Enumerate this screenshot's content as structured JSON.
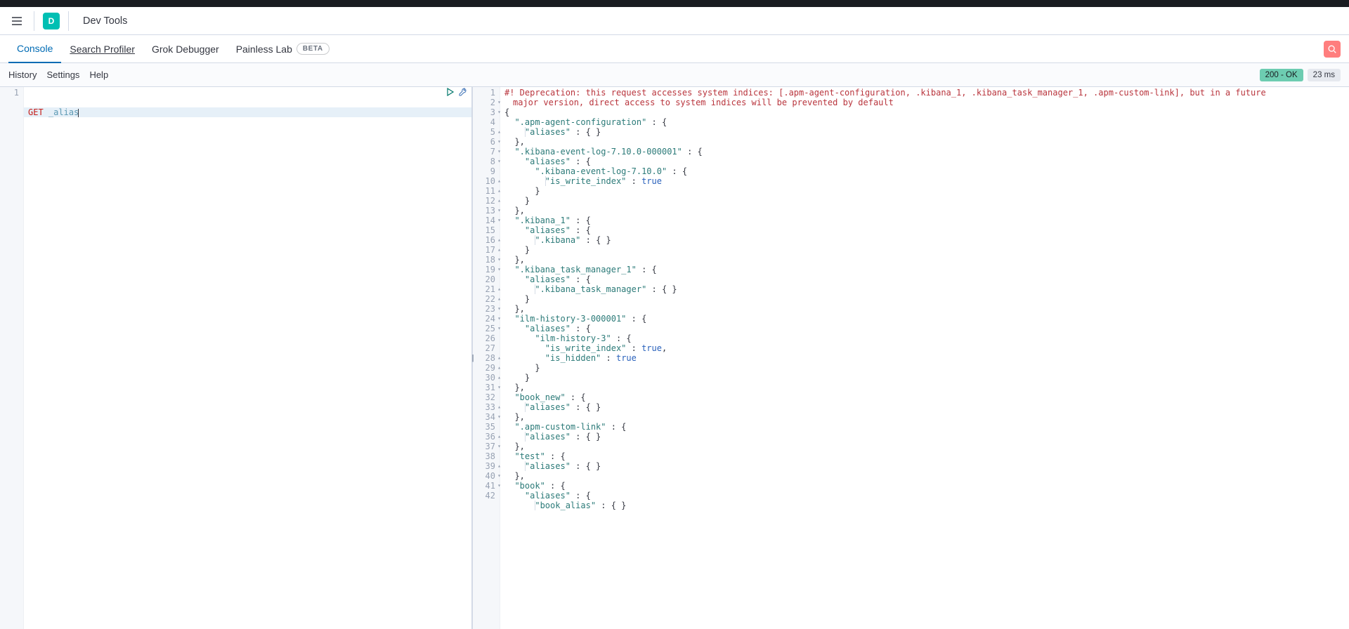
{
  "app": {
    "badge_letter": "D",
    "title": "Dev Tools"
  },
  "tabs": {
    "console": "Console",
    "search_profiler": "Search Profiler",
    "grok_debugger": "Grok Debugger",
    "painless_lab": "Painless Lab",
    "beta_badge": "BETA"
  },
  "subbar": {
    "history": "History",
    "settings": "Settings",
    "help": "Help",
    "status": "200 - OK",
    "time": "23 ms"
  },
  "request": {
    "line_numbers": [
      "1"
    ],
    "method": "GET",
    "path": "_alias"
  },
  "response": {
    "gutter": [
      {
        "n": "1",
        "f": ""
      },
      {
        "n": "2",
        "f": "fold"
      },
      {
        "n": "3",
        "f": "fold"
      },
      {
        "n": "4",
        "f": ""
      },
      {
        "n": "5",
        "f": "foldend"
      },
      {
        "n": "6",
        "f": "fold"
      },
      {
        "n": "7",
        "f": "fold"
      },
      {
        "n": "8",
        "f": "fold"
      },
      {
        "n": "9",
        "f": ""
      },
      {
        "n": "10",
        "f": "foldend"
      },
      {
        "n": "11",
        "f": "foldend"
      },
      {
        "n": "12",
        "f": "foldend"
      },
      {
        "n": "13",
        "f": "fold"
      },
      {
        "n": "14",
        "f": "fold"
      },
      {
        "n": "15",
        "f": ""
      },
      {
        "n": "16",
        "f": "foldend"
      },
      {
        "n": "17",
        "f": "foldend"
      },
      {
        "n": "18",
        "f": "fold"
      },
      {
        "n": "19",
        "f": "fold"
      },
      {
        "n": "20",
        "f": ""
      },
      {
        "n": "21",
        "f": "foldend"
      },
      {
        "n": "22",
        "f": "foldend"
      },
      {
        "n": "23",
        "f": "fold"
      },
      {
        "n": "24",
        "f": "fold"
      },
      {
        "n": "25",
        "f": "fold"
      },
      {
        "n": "26",
        "f": ""
      },
      {
        "n": "27",
        "f": ""
      },
      {
        "n": "28",
        "f": "foldend"
      },
      {
        "n": "29",
        "f": "foldend"
      },
      {
        "n": "30",
        "f": "foldend"
      },
      {
        "n": "31",
        "f": "fold"
      },
      {
        "n": "32",
        "f": ""
      },
      {
        "n": "33",
        "f": "foldend"
      },
      {
        "n": "34",
        "f": "fold"
      },
      {
        "n": "35",
        "f": ""
      },
      {
        "n": "36",
        "f": "foldend"
      },
      {
        "n": "37",
        "f": "fold"
      },
      {
        "n": "38",
        "f": ""
      },
      {
        "n": "39",
        "f": "foldend"
      },
      {
        "n": "40",
        "f": "fold"
      },
      {
        "n": "41",
        "f": "fold"
      },
      {
        "n": "42",
        "f": ""
      }
    ],
    "deprecation_line1": "#! Deprecation: this request accesses system indices: [.apm-agent-configuration, .kibana_1, .kibana_task_manager_1, .apm-custom-link], but in a future",
    "deprecation_line2": "major version, direct access to system indices will be prevented by default",
    "tokens": [
      [],
      [
        {
          "t": "punc",
          "v": "{"
        }
      ],
      [
        {
          "t": "sp",
          "v": "  "
        },
        {
          "t": "key",
          "v": "\".apm-agent-configuration\""
        },
        {
          "t": "punc",
          "v": " : {"
        }
      ],
      [
        {
          "t": "sp",
          "v": "    "
        },
        {
          "t": "guide"
        },
        {
          "t": "key",
          "v": "\"aliases\""
        },
        {
          "t": "punc",
          "v": " : { }"
        }
      ],
      [
        {
          "t": "sp",
          "v": "  "
        },
        {
          "t": "punc",
          "v": "},"
        }
      ],
      [
        {
          "t": "sp",
          "v": "  "
        },
        {
          "t": "key",
          "v": "\".kibana-event-log-7.10.0-000001\""
        },
        {
          "t": "punc",
          "v": " : {"
        }
      ],
      [
        {
          "t": "sp",
          "v": "    "
        },
        {
          "t": "key",
          "v": "\"aliases\""
        },
        {
          "t": "punc",
          "v": " : {"
        }
      ],
      [
        {
          "t": "sp",
          "v": "      "
        },
        {
          "t": "key",
          "v": "\".kibana-event-log-7.10.0\""
        },
        {
          "t": "punc",
          "v": " : {"
        }
      ],
      [
        {
          "t": "sp",
          "v": "        "
        },
        {
          "t": "guide"
        },
        {
          "t": "key",
          "v": "\"is_write_index\""
        },
        {
          "t": "punc",
          "v": " : "
        },
        {
          "t": "bool",
          "v": "true"
        }
      ],
      [
        {
          "t": "sp",
          "v": "      "
        },
        {
          "t": "punc",
          "v": "}"
        }
      ],
      [
        {
          "t": "sp",
          "v": "    "
        },
        {
          "t": "punc",
          "v": "}"
        }
      ],
      [
        {
          "t": "sp",
          "v": "  "
        },
        {
          "t": "punc",
          "v": "},"
        }
      ],
      [
        {
          "t": "sp",
          "v": "  "
        },
        {
          "t": "key",
          "v": "\".kibana_1\""
        },
        {
          "t": "punc",
          "v": " : {"
        }
      ],
      [
        {
          "t": "sp",
          "v": "    "
        },
        {
          "t": "key",
          "v": "\"aliases\""
        },
        {
          "t": "punc",
          "v": " : {"
        }
      ],
      [
        {
          "t": "sp",
          "v": "      "
        },
        {
          "t": "guide"
        },
        {
          "t": "key",
          "v": "\".kibana\""
        },
        {
          "t": "punc",
          "v": " : { }"
        }
      ],
      [
        {
          "t": "sp",
          "v": "    "
        },
        {
          "t": "punc",
          "v": "}"
        }
      ],
      [
        {
          "t": "sp",
          "v": "  "
        },
        {
          "t": "punc",
          "v": "},"
        }
      ],
      [
        {
          "t": "sp",
          "v": "  "
        },
        {
          "t": "key",
          "v": "\".kibana_task_manager_1\""
        },
        {
          "t": "punc",
          "v": " : {"
        }
      ],
      [
        {
          "t": "sp",
          "v": "    "
        },
        {
          "t": "key",
          "v": "\"aliases\""
        },
        {
          "t": "punc",
          "v": " : {"
        }
      ],
      [
        {
          "t": "sp",
          "v": "      "
        },
        {
          "t": "guide"
        },
        {
          "t": "key",
          "v": "\".kibana_task_manager\""
        },
        {
          "t": "punc",
          "v": " : { }"
        }
      ],
      [
        {
          "t": "sp",
          "v": "    "
        },
        {
          "t": "punc",
          "v": "}"
        }
      ],
      [
        {
          "t": "sp",
          "v": "  "
        },
        {
          "t": "punc",
          "v": "},"
        }
      ],
      [
        {
          "t": "sp",
          "v": "  "
        },
        {
          "t": "key",
          "v": "\"ilm-history-3-000001\""
        },
        {
          "t": "punc",
          "v": " : {"
        }
      ],
      [
        {
          "t": "sp",
          "v": "    "
        },
        {
          "t": "key",
          "v": "\"aliases\""
        },
        {
          "t": "punc",
          "v": " : {"
        }
      ],
      [
        {
          "t": "sp",
          "v": "      "
        },
        {
          "t": "key",
          "v": "\"ilm-history-3\""
        },
        {
          "t": "punc",
          "v": " : {"
        }
      ],
      [
        {
          "t": "sp",
          "v": "        "
        },
        {
          "t": "key",
          "v": "\"is_write_index\""
        },
        {
          "t": "punc",
          "v": " : "
        },
        {
          "t": "bool",
          "v": "true"
        },
        {
          "t": "punc",
          "v": ","
        }
      ],
      [
        {
          "t": "sp",
          "v": "        "
        },
        {
          "t": "key",
          "v": "\"is_hidden\""
        },
        {
          "t": "punc",
          "v": " : "
        },
        {
          "t": "bool",
          "v": "true"
        }
      ],
      [
        {
          "t": "sp",
          "v": "      "
        },
        {
          "t": "punc",
          "v": "}"
        }
      ],
      [
        {
          "t": "sp",
          "v": "    "
        },
        {
          "t": "punc",
          "v": "}"
        }
      ],
      [
        {
          "t": "sp",
          "v": "  "
        },
        {
          "t": "punc",
          "v": "},"
        }
      ],
      [
        {
          "t": "sp",
          "v": "  "
        },
        {
          "t": "key",
          "v": "\"book_new\""
        },
        {
          "t": "punc",
          "v": " : {"
        }
      ],
      [
        {
          "t": "sp",
          "v": "    "
        },
        {
          "t": "guide"
        },
        {
          "t": "key",
          "v": "\"aliases\""
        },
        {
          "t": "punc",
          "v": " : { }"
        }
      ],
      [
        {
          "t": "sp",
          "v": "  "
        },
        {
          "t": "punc",
          "v": "},"
        }
      ],
      [
        {
          "t": "sp",
          "v": "  "
        },
        {
          "t": "key",
          "v": "\".apm-custom-link\""
        },
        {
          "t": "punc",
          "v": " : {"
        }
      ],
      [
        {
          "t": "sp",
          "v": "    "
        },
        {
          "t": "guide"
        },
        {
          "t": "key",
          "v": "\"aliases\""
        },
        {
          "t": "punc",
          "v": " : { }"
        }
      ],
      [
        {
          "t": "sp",
          "v": "  "
        },
        {
          "t": "punc",
          "v": "},"
        }
      ],
      [
        {
          "t": "sp",
          "v": "  "
        },
        {
          "t": "key",
          "v": "\"test\""
        },
        {
          "t": "punc",
          "v": " : {"
        }
      ],
      [
        {
          "t": "sp",
          "v": "    "
        },
        {
          "t": "guide"
        },
        {
          "t": "key",
          "v": "\"aliases\""
        },
        {
          "t": "punc",
          "v": " : { }"
        }
      ],
      [
        {
          "t": "sp",
          "v": "  "
        },
        {
          "t": "punc",
          "v": "},"
        }
      ],
      [
        {
          "t": "sp",
          "v": "  "
        },
        {
          "t": "key",
          "v": "\"book\""
        },
        {
          "t": "punc",
          "v": " : {"
        }
      ],
      [
        {
          "t": "sp",
          "v": "    "
        },
        {
          "t": "key",
          "v": "\"aliases\""
        },
        {
          "t": "punc",
          "v": " : {"
        }
      ],
      [
        {
          "t": "sp",
          "v": "      "
        },
        {
          "t": "guide"
        },
        {
          "t": "key",
          "v": "\"book_alias\""
        },
        {
          "t": "punc",
          "v": " : { }"
        }
      ]
    ]
  }
}
